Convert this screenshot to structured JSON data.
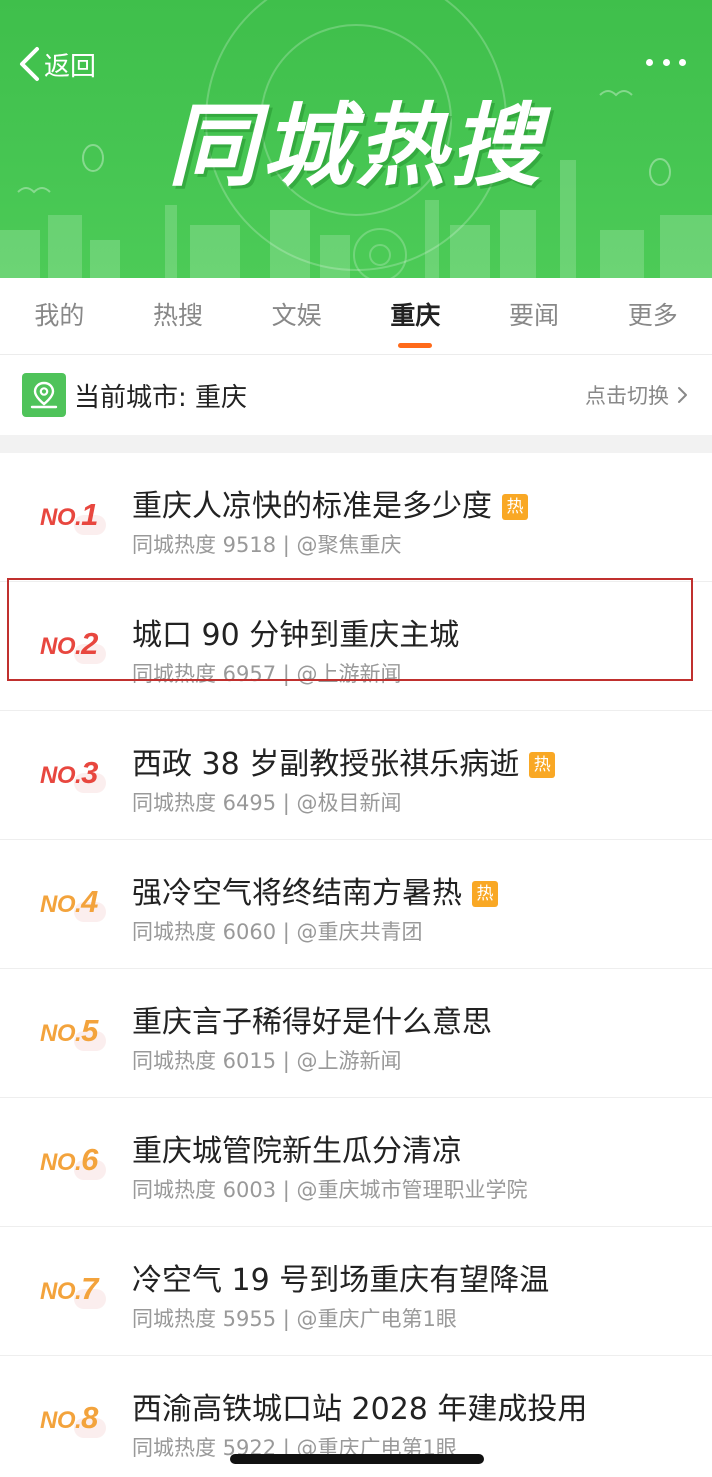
{
  "header": {
    "back_label": "返回",
    "title": "同城热搜",
    "brand_color": "#46c552"
  },
  "tabs": [
    {
      "label": "我的",
      "active": false
    },
    {
      "label": "热搜",
      "active": false
    },
    {
      "label": "文娱",
      "active": false
    },
    {
      "label": "重庆",
      "active": true
    },
    {
      "label": "要闻",
      "active": false
    },
    {
      "label": "更多",
      "active": false
    }
  ],
  "city": {
    "label": "当前城市: 重庆",
    "switch_label": "点击切换"
  },
  "list": [
    {
      "rank_prefix": "NO.",
      "rank": "1",
      "title": "重庆人凉快的标准是多少度",
      "hot": "热",
      "meta": "同城热度 9518 | @聚焦重庆",
      "color": "#e8473f"
    },
    {
      "rank_prefix": "NO.",
      "rank": "2",
      "title": "城口 90 分钟到重庆主城",
      "hot": "",
      "meta": "同城热度 6957 | @上游新闻",
      "color": "#e8473f"
    },
    {
      "rank_prefix": "NO.",
      "rank": "3",
      "title": "西政 38 岁副教授张祺乐病逝",
      "hot": "热",
      "meta": "同城热度 6495 | @极目新闻",
      "color": "#e8473f"
    },
    {
      "rank_prefix": "NO.",
      "rank": "4",
      "title": "强冷空气将终结南方暑热",
      "hot": "热",
      "meta": "同城热度 6060 | @重庆共青团",
      "color": "#f3a33c"
    },
    {
      "rank_prefix": "NO.",
      "rank": "5",
      "title": "重庆言子稀得好是什么意思",
      "hot": "",
      "meta": "同城热度 6015 | @上游新闻",
      "color": "#f3a33c"
    },
    {
      "rank_prefix": "NO.",
      "rank": "6",
      "title": "重庆城管院新生瓜分清凉",
      "hot": "",
      "meta": "同城热度 6003 | @重庆城市管理职业学院",
      "color": "#f3a33c"
    },
    {
      "rank_prefix": "NO.",
      "rank": "7",
      "title": "冷空气 19 号到场重庆有望降温",
      "hot": "",
      "meta": "同城热度 5955 | @重庆广电第1眼",
      "color": "#f3a33c"
    },
    {
      "rank_prefix": "NO.",
      "rank": "8",
      "title": "西渝高铁城口站 2028 年建成投用",
      "hot": "",
      "meta": "同城热度 5922 | @重庆广电第1眼",
      "color": "#f3a33c"
    }
  ]
}
